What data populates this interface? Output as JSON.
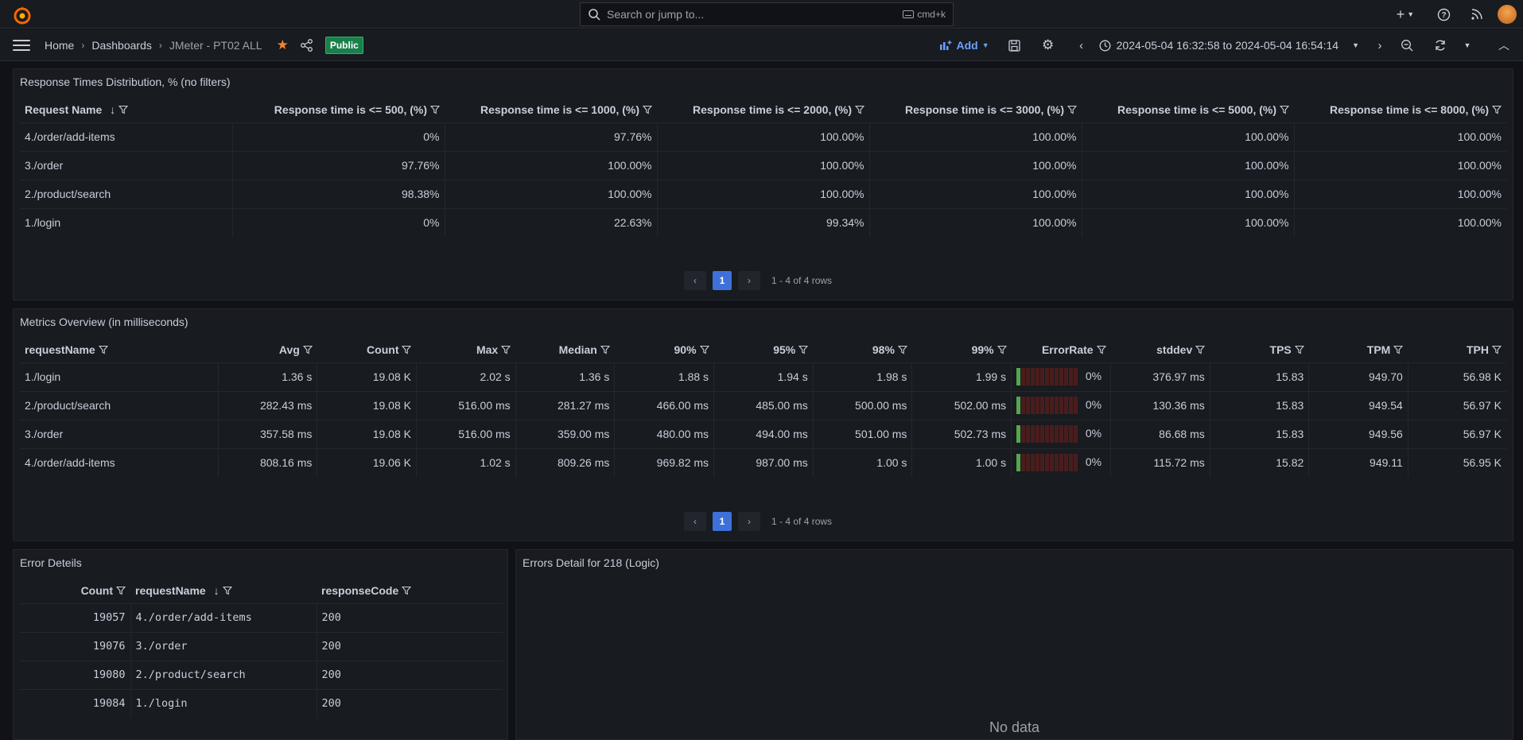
{
  "topbar": {
    "search_placeholder": "Search or jump to...",
    "search_shortcut": "cmd+k",
    "icons": [
      "grafana-logo-icon",
      "plus-icon",
      "help-icon",
      "rss-icon",
      "avatar"
    ]
  },
  "navbar": {
    "breadcrumbs": [
      "Home",
      "Dashboards",
      "JMeter - PT02 ALL"
    ],
    "public_badge": "Public",
    "add_label": "Add",
    "time_range": "2024-05-04 16:32:58 to 2024-05-04 16:54:14"
  },
  "colors": {
    "accent": "#3d71d9",
    "link": "#6e9fff",
    "star": "#f5822d",
    "public_badge": "#1a7f4b",
    "gauge_on": "#56a64b",
    "gauge_off": "#4a1d1d"
  },
  "distribution": {
    "title": "Response Times Distribution, % (no filters)",
    "headers": [
      "Request Name",
      "Response time is <= 500, (%)",
      "Response time is <= 1000, (%)",
      "Response time is <= 2000, (%)",
      "Response time is <= 3000, (%)",
      "Response time is <= 5000, (%)",
      "Response time is <= 8000, (%)"
    ],
    "rows": [
      [
        "4./order/add-items",
        "0%",
        "97.76%",
        "100.00%",
        "100.00%",
        "100.00%",
        "100.00%"
      ],
      [
        "3./order",
        "97.76%",
        "100.00%",
        "100.00%",
        "100.00%",
        "100.00%",
        "100.00%"
      ],
      [
        "2./product/search",
        "98.38%",
        "100.00%",
        "100.00%",
        "100.00%",
        "100.00%",
        "100.00%"
      ],
      [
        "1./login",
        "0%",
        "22.63%",
        "99.34%",
        "100.00%",
        "100.00%",
        "100.00%"
      ]
    ],
    "pager": {
      "page": "1",
      "info": "1 - 4 of 4 rows"
    }
  },
  "metrics": {
    "title": "Metrics Overview (in milliseconds)",
    "headers": [
      "requestName",
      "Avg",
      "Count",
      "Max",
      "Median",
      "90%",
      "95%",
      "98%",
      "99%",
      "ErrorRate",
      "stddev",
      "TPS",
      "TPM",
      "TPH"
    ],
    "rows": [
      [
        "1./login",
        "1.36 s",
        "19.08 K",
        "2.02 s",
        "1.36 s",
        "1.88 s",
        "1.94 s",
        "1.98 s",
        "1.99 s",
        "0%",
        "376.97 ms",
        "15.83",
        "949.70",
        "56.98 K"
      ],
      [
        "2./product/search",
        "282.43 ms",
        "19.08 K",
        "516.00 ms",
        "281.27 ms",
        "466.00 ms",
        "485.00 ms",
        "500.00 ms",
        "502.00 ms",
        "0%",
        "130.36 ms",
        "15.83",
        "949.54",
        "56.97 K"
      ],
      [
        "3./order",
        "357.58 ms",
        "19.08 K",
        "516.00 ms",
        "359.00 ms",
        "480.00 ms",
        "494.00 ms",
        "501.00 ms",
        "502.73 ms",
        "0%",
        "86.68 ms",
        "15.83",
        "949.56",
        "56.97 K"
      ],
      [
        "4./order/add-items",
        "808.16 ms",
        "19.06 K",
        "1.02 s",
        "809.26 ms",
        "969.82 ms",
        "987.00 ms",
        "1.00 s",
        "1.00 s",
        "0%",
        "115.72 ms",
        "15.82",
        "949.11",
        "56.95 K"
      ]
    ],
    "error_rate_fraction": [
      0,
      0,
      0,
      0
    ],
    "pager": {
      "page": "1",
      "info": "1 - 4 of 4 rows"
    }
  },
  "errors": {
    "title": "Error Deteils",
    "headers": [
      "Count",
      "requestName",
      "responseCode"
    ],
    "rows": [
      [
        "19057",
        "4./order/add-items",
        "200"
      ],
      [
        "19076",
        "3./order",
        "200"
      ],
      [
        "19080",
        "2./product/search",
        "200"
      ],
      [
        "19084",
        "1./login",
        "200"
      ]
    ]
  },
  "errors_detail": {
    "title": "Errors Detail for 218 (Logic)",
    "empty_text": "No data"
  }
}
